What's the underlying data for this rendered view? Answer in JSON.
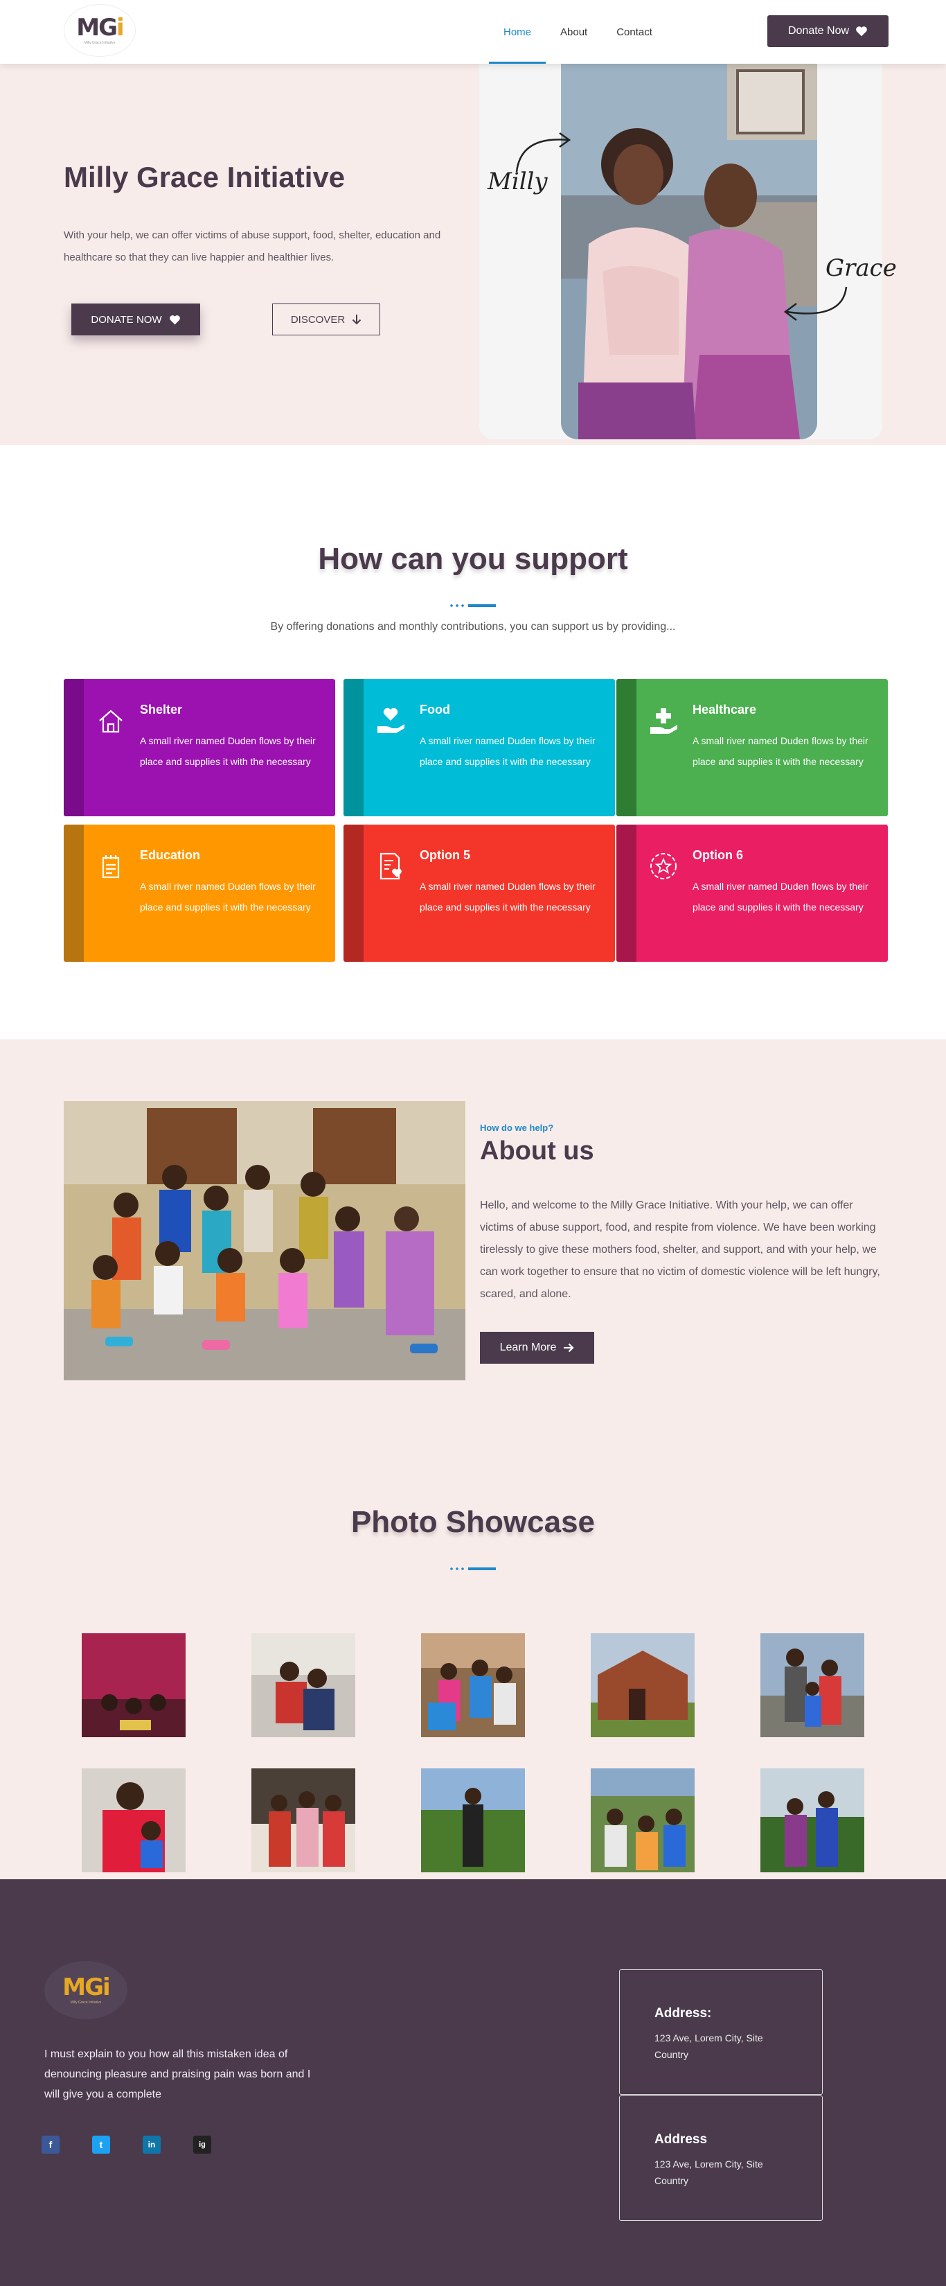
{
  "nav": {
    "logo_text": "MG",
    "logo_i": "i",
    "logo_tagline": "Milly Grace Initiative",
    "links": [
      "Home",
      "About",
      "Contact"
    ],
    "donate_label": "Donate Now"
  },
  "hero": {
    "title": "Milly Grace Initiative",
    "description": "With your help, we can offer victims of abuse support, food, shelter, education and healthcare so that they can live happier and healthier lives.",
    "donate_label": "DONATE NOW",
    "discover_label": "DISCOVER",
    "script_left": "Milly",
    "script_right": "Grace"
  },
  "support": {
    "title": "How can you support",
    "subtitle": "By offering donations and monthly contributions, you can support us by providing...",
    "cards": [
      {
        "title": "Shelter",
        "text": "A small river named Duden flows by their place and supplies it with the necessary",
        "color": "#9c12b0",
        "stripe": "#7a0b8a",
        "icon": "house-icon"
      },
      {
        "title": "Food",
        "text": "A small river named Duden flows by their place and supplies it with the necessary",
        "color": "#00bcd6",
        "stripe": "#00939e",
        "icon": "heart-hand-icon"
      },
      {
        "title": "Healthcare",
        "text": "A small river named Duden flows by their place and supplies it with the necessary",
        "color": "#4caf50",
        "stripe": "#2e7d32",
        "icon": "medical-cross-hand-icon"
      },
      {
        "title": "Education",
        "text": "A small river named Duden flows by their place and supplies it with the necessary",
        "color": "#ff9800",
        "stripe": "#b8740f",
        "icon": "school-icon"
      },
      {
        "title": "Option 5",
        "text": "A small river named Duden flows by their place and supplies it with the necessary",
        "color": "#f4362a",
        "stripe": "#b32820",
        "icon": "document-heart-icon"
      },
      {
        "title": "Option 6",
        "text": "A small river named Duden flows by their place and supplies it with the necessary",
        "color": "#e91e63",
        "stripe": "#a8174a",
        "icon": "laurel-star-icon"
      }
    ]
  },
  "about": {
    "kicker": "How do we help?",
    "title": "About us",
    "text": "Hello, and welcome to the Milly Grace Initiative. With your help, we can offer victims of abuse support, food, and respite from violence. We have been working tirelessly to give these mothers food, shelter, and support, and with your help, we can work together to ensure that no victim of domestic violence will be left hungry, scared, and alone.",
    "button_label": "Learn More"
  },
  "showcase": {
    "title": "Photo Showcase"
  },
  "footer": {
    "logo_text": "MG",
    "logo_i": "i",
    "logo_tagline": "Milly Grace Initiative",
    "text": "I must explain to you how all this mistaken idea of denouncing pleasure and praising pain was born and I will give you a complete",
    "social": [
      "f",
      "t",
      "in",
      "ig"
    ],
    "addresses": [
      {
        "title": "Address:",
        "text": "123 Ave, Lorem City, Site Country"
      },
      {
        "title": "Address",
        "text": "123 Ave, Lorem City, Site Country"
      }
    ]
  }
}
